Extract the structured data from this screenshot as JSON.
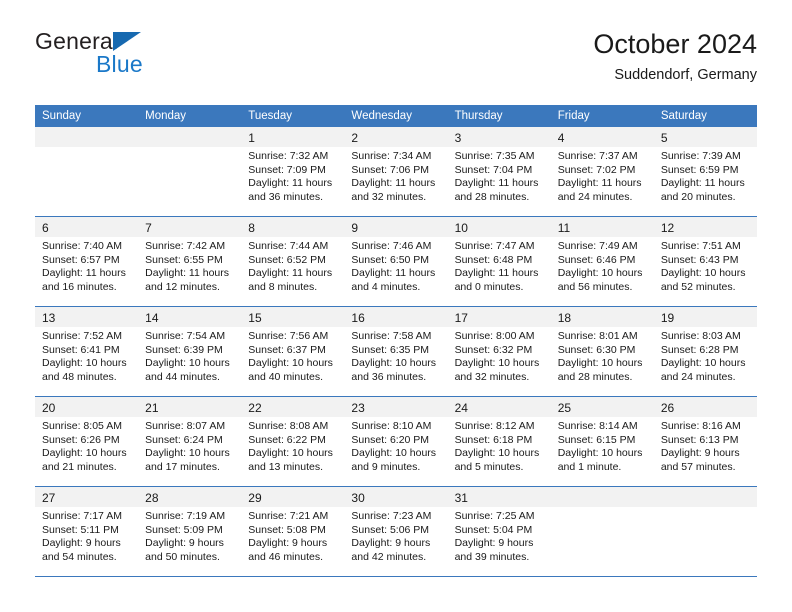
{
  "brand": {
    "name_top": "General",
    "name_bottom": "Blue",
    "accent_color": "#1769b0",
    "blue_text_color": "#1a78c8"
  },
  "header": {
    "title": "October 2024",
    "subtitle": "Suddendorf, Germany"
  },
  "theme": {
    "header_bg": "#3b78bd",
    "daynum_bg": "#f2f2f2",
    "rule_color": "#3b78bd",
    "text_color": "#1a1a1a"
  },
  "weekdays": [
    "Sunday",
    "Monday",
    "Tuesday",
    "Wednesday",
    "Thursday",
    "Friday",
    "Saturday"
  ],
  "weeks": [
    [
      {
        "day": "",
        "sunrise": "",
        "sunset": "",
        "daylight_1": "",
        "daylight_2": ""
      },
      {
        "day": "",
        "sunrise": "",
        "sunset": "",
        "daylight_1": "",
        "daylight_2": ""
      },
      {
        "day": "1",
        "sunrise": "Sunrise: 7:32 AM",
        "sunset": "Sunset: 7:09 PM",
        "daylight_1": "Daylight: 11 hours",
        "daylight_2": "and 36 minutes."
      },
      {
        "day": "2",
        "sunrise": "Sunrise: 7:34 AM",
        "sunset": "Sunset: 7:06 PM",
        "daylight_1": "Daylight: 11 hours",
        "daylight_2": "and 32 minutes."
      },
      {
        "day": "3",
        "sunrise": "Sunrise: 7:35 AM",
        "sunset": "Sunset: 7:04 PM",
        "daylight_1": "Daylight: 11 hours",
        "daylight_2": "and 28 minutes."
      },
      {
        "day": "4",
        "sunrise": "Sunrise: 7:37 AM",
        "sunset": "Sunset: 7:02 PM",
        "daylight_1": "Daylight: 11 hours",
        "daylight_2": "and 24 minutes."
      },
      {
        "day": "5",
        "sunrise": "Sunrise: 7:39 AM",
        "sunset": "Sunset: 6:59 PM",
        "daylight_1": "Daylight: 11 hours",
        "daylight_2": "and 20 minutes."
      }
    ],
    [
      {
        "day": "6",
        "sunrise": "Sunrise: 7:40 AM",
        "sunset": "Sunset: 6:57 PM",
        "daylight_1": "Daylight: 11 hours",
        "daylight_2": "and 16 minutes."
      },
      {
        "day": "7",
        "sunrise": "Sunrise: 7:42 AM",
        "sunset": "Sunset: 6:55 PM",
        "daylight_1": "Daylight: 11 hours",
        "daylight_2": "and 12 minutes."
      },
      {
        "day": "8",
        "sunrise": "Sunrise: 7:44 AM",
        "sunset": "Sunset: 6:52 PM",
        "daylight_1": "Daylight: 11 hours",
        "daylight_2": "and 8 minutes."
      },
      {
        "day": "9",
        "sunrise": "Sunrise: 7:46 AM",
        "sunset": "Sunset: 6:50 PM",
        "daylight_1": "Daylight: 11 hours",
        "daylight_2": "and 4 minutes."
      },
      {
        "day": "10",
        "sunrise": "Sunrise: 7:47 AM",
        "sunset": "Sunset: 6:48 PM",
        "daylight_1": "Daylight: 11 hours",
        "daylight_2": "and 0 minutes."
      },
      {
        "day": "11",
        "sunrise": "Sunrise: 7:49 AM",
        "sunset": "Sunset: 6:46 PM",
        "daylight_1": "Daylight: 10 hours",
        "daylight_2": "and 56 minutes."
      },
      {
        "day": "12",
        "sunrise": "Sunrise: 7:51 AM",
        "sunset": "Sunset: 6:43 PM",
        "daylight_1": "Daylight: 10 hours",
        "daylight_2": "and 52 minutes."
      }
    ],
    [
      {
        "day": "13",
        "sunrise": "Sunrise: 7:52 AM",
        "sunset": "Sunset: 6:41 PM",
        "daylight_1": "Daylight: 10 hours",
        "daylight_2": "and 48 minutes."
      },
      {
        "day": "14",
        "sunrise": "Sunrise: 7:54 AM",
        "sunset": "Sunset: 6:39 PM",
        "daylight_1": "Daylight: 10 hours",
        "daylight_2": "and 44 minutes."
      },
      {
        "day": "15",
        "sunrise": "Sunrise: 7:56 AM",
        "sunset": "Sunset: 6:37 PM",
        "daylight_1": "Daylight: 10 hours",
        "daylight_2": "and 40 minutes."
      },
      {
        "day": "16",
        "sunrise": "Sunrise: 7:58 AM",
        "sunset": "Sunset: 6:35 PM",
        "daylight_1": "Daylight: 10 hours",
        "daylight_2": "and 36 minutes."
      },
      {
        "day": "17",
        "sunrise": "Sunrise: 8:00 AM",
        "sunset": "Sunset: 6:32 PM",
        "daylight_1": "Daylight: 10 hours",
        "daylight_2": "and 32 minutes."
      },
      {
        "day": "18",
        "sunrise": "Sunrise: 8:01 AM",
        "sunset": "Sunset: 6:30 PM",
        "daylight_1": "Daylight: 10 hours",
        "daylight_2": "and 28 minutes."
      },
      {
        "day": "19",
        "sunrise": "Sunrise: 8:03 AM",
        "sunset": "Sunset: 6:28 PM",
        "daylight_1": "Daylight: 10 hours",
        "daylight_2": "and 24 minutes."
      }
    ],
    [
      {
        "day": "20",
        "sunrise": "Sunrise: 8:05 AM",
        "sunset": "Sunset: 6:26 PM",
        "daylight_1": "Daylight: 10 hours",
        "daylight_2": "and 21 minutes."
      },
      {
        "day": "21",
        "sunrise": "Sunrise: 8:07 AM",
        "sunset": "Sunset: 6:24 PM",
        "daylight_1": "Daylight: 10 hours",
        "daylight_2": "and 17 minutes."
      },
      {
        "day": "22",
        "sunrise": "Sunrise: 8:08 AM",
        "sunset": "Sunset: 6:22 PM",
        "daylight_1": "Daylight: 10 hours",
        "daylight_2": "and 13 minutes."
      },
      {
        "day": "23",
        "sunrise": "Sunrise: 8:10 AM",
        "sunset": "Sunset: 6:20 PM",
        "daylight_1": "Daylight: 10 hours",
        "daylight_2": "and 9 minutes."
      },
      {
        "day": "24",
        "sunrise": "Sunrise: 8:12 AM",
        "sunset": "Sunset: 6:18 PM",
        "daylight_1": "Daylight: 10 hours",
        "daylight_2": "and 5 minutes."
      },
      {
        "day": "25",
        "sunrise": "Sunrise: 8:14 AM",
        "sunset": "Sunset: 6:15 PM",
        "daylight_1": "Daylight: 10 hours",
        "daylight_2": "and 1 minute."
      },
      {
        "day": "26",
        "sunrise": "Sunrise: 8:16 AM",
        "sunset": "Sunset: 6:13 PM",
        "daylight_1": "Daylight: 9 hours",
        "daylight_2": "and 57 minutes."
      }
    ],
    [
      {
        "day": "27",
        "sunrise": "Sunrise: 7:17 AM",
        "sunset": "Sunset: 5:11 PM",
        "daylight_1": "Daylight: 9 hours",
        "daylight_2": "and 54 minutes."
      },
      {
        "day": "28",
        "sunrise": "Sunrise: 7:19 AM",
        "sunset": "Sunset: 5:09 PM",
        "daylight_1": "Daylight: 9 hours",
        "daylight_2": "and 50 minutes."
      },
      {
        "day": "29",
        "sunrise": "Sunrise: 7:21 AM",
        "sunset": "Sunset: 5:08 PM",
        "daylight_1": "Daylight: 9 hours",
        "daylight_2": "and 46 minutes."
      },
      {
        "day": "30",
        "sunrise": "Sunrise: 7:23 AM",
        "sunset": "Sunset: 5:06 PM",
        "daylight_1": "Daylight: 9 hours",
        "daylight_2": "and 42 minutes."
      },
      {
        "day": "31",
        "sunrise": "Sunrise: 7:25 AM",
        "sunset": "Sunset: 5:04 PM",
        "daylight_1": "Daylight: 9 hours",
        "daylight_2": "and 39 minutes."
      },
      {
        "day": "",
        "sunrise": "",
        "sunset": "",
        "daylight_1": "",
        "daylight_2": ""
      },
      {
        "day": "",
        "sunrise": "",
        "sunset": "",
        "daylight_1": "",
        "daylight_2": ""
      }
    ]
  ]
}
